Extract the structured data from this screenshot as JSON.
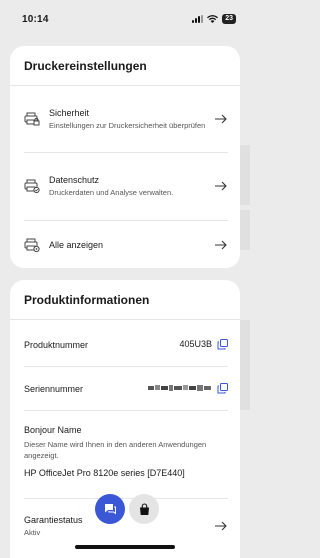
{
  "status_bar": {
    "time": "10:14",
    "battery": "23"
  },
  "printer_settings": {
    "title": "Druckereinstellungen",
    "items": [
      {
        "label": "Sicherheit",
        "description": "Einstellungen zur Druckersicherheit überprüfen",
        "icon": "printer-lock-icon"
      },
      {
        "label": "Datenschutz",
        "description": "Druckerdaten und Analyse verwalten.",
        "icon": "printer-privacy-icon"
      },
      {
        "label": "Alle anzeigen",
        "description": "",
        "icon": "printer-settings-icon"
      }
    ]
  },
  "product_info": {
    "title": "Produktinformationen",
    "product_number_label": "Produktnummer",
    "product_number_value": "405U3B",
    "serial_number_label": "Seriennummer",
    "bonjour_label": "Bonjour Name",
    "bonjour_desc": "Dieser Name wird Ihnen in den anderen Anwendungen angezeigt.",
    "bonjour_value": "HP OfficeJet Pro 8120e series [D7E440]",
    "warranty_label": "Garantiestatus",
    "warranty_value": "Aktiv"
  },
  "colors": {
    "accent": "#3a58d6",
    "background": "#ebebeb",
    "card": "#ffffff"
  }
}
